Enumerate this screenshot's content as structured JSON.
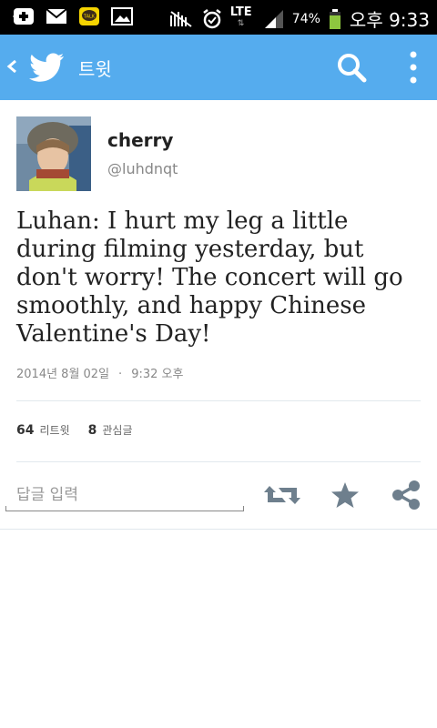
{
  "status_bar": {
    "battery": "74%",
    "time": "오후 9:33",
    "network": "LTE"
  },
  "app_bar": {
    "title": "트윗",
    "accent_color": "#55acee"
  },
  "tweet": {
    "display_name": "cherry",
    "handle": "@luhdnqt",
    "text": "Luhan: I hurt my leg a little during filming yesterday, but don't worry! The concert will go smoothly, and happy Chinese Valentine's Day!",
    "date": "2014년 8월 02일",
    "separator": "·",
    "time": "9:32 오후",
    "retweet_count": "64",
    "retweet_label": "리트윗",
    "favorite_count": "8",
    "favorite_label": "관심글"
  },
  "reply": {
    "placeholder": "답글 입력"
  },
  "icons": {
    "back": "chevron-left-icon",
    "logo": "twitter-bird-icon",
    "search": "search-icon",
    "menu": "overflow-menu-icon",
    "retweet": "retweet-icon",
    "favorite": "star-icon",
    "share": "share-icon"
  }
}
